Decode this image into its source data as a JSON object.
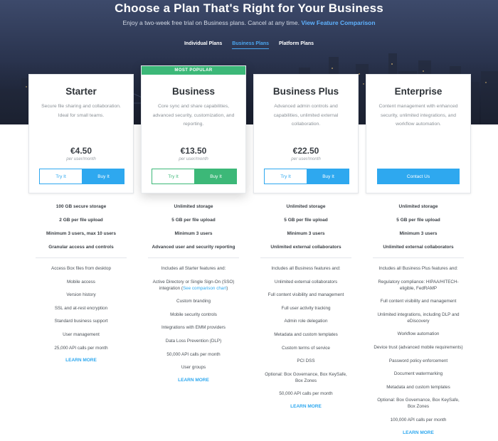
{
  "hero": {
    "title": "Choose a Plan That's Right for Your Business",
    "subtitle": "Enjoy a two-week free trial on Business plans. Cancel at any time.",
    "subtitle_link": "View Feature Comparison"
  },
  "tabs": [
    {
      "label": "Individual Plans",
      "active": false
    },
    {
      "label": "Business Plans",
      "active": true
    },
    {
      "label": "Platform Plans",
      "active": false
    }
  ],
  "colors": {
    "accent": "#2ea8ef",
    "popular": "#3cb878"
  },
  "plans": [
    {
      "name": "Starter",
      "description": "Secure file sharing and collaboration. Ideal for small teams.",
      "price": "€4.50",
      "per": "per user/month",
      "try_label": "Try It",
      "buy_label": "Buy It",
      "key_features": [
        "100 GB secure storage",
        "2 GB per file upload",
        "Minimum 3 users, max 10 users",
        "Granular access and controls"
      ],
      "features": [
        "Access Box files from desktop",
        "Mobile access",
        "Version history",
        "SSL and at-rest encryption",
        "Standard business support",
        "User management",
        "25,000 API calls per month"
      ],
      "learn_more": "LEARN MORE"
    },
    {
      "name": "Business",
      "badge": "MOST POPULAR",
      "description": "Core sync and share capabilities, advanced security, customization, and reporting.",
      "price": "€13.50",
      "per": "per user/month",
      "try_label": "Try It",
      "buy_label": "Buy It",
      "key_features": [
        "Unlimited storage",
        "5 GB per file upload",
        "Minimum 3 users",
        "Advanced user and security reporting"
      ],
      "features": [
        "Includes all Starter features and:",
        "Active Directory or Single Sign-On (SSO)",
        "Custom branding",
        "Mobile security controls",
        "Integrations with EMM providers",
        "Data Loss Prevention (DLP)",
        "50,000 API calls per month",
        "User groups"
      ],
      "sso_prefix": "integration (",
      "sso_link": "See comparison chart",
      "sso_suffix": ")",
      "learn_more": "LEARN MORE"
    },
    {
      "name": "Business Plus",
      "description": "Advanced admin controls and capabilities, unlimited external collaboration.",
      "price": "€22.50",
      "per": "per user/month",
      "try_label": "Try It",
      "buy_label": "Buy It",
      "key_features": [
        "Unlimited storage",
        "5 GB per file upload",
        "Minimum 3 users",
        "Unlimited external collaborators"
      ],
      "features": [
        "Includes all Business features and:",
        "Unlimited external collaborators",
        "Full content visibility and management",
        "Full user activity tracking",
        "Admin role delegation",
        "Metadata and custom templates",
        "Custom terms of service",
        "PCI DSS",
        "Optional: Box Governance, Box KeySafe, Box Zones",
        "50,000 API calls per month"
      ],
      "learn_more": "LEARN MORE"
    },
    {
      "name": "Enterprise",
      "description": "Content management with enhanced security, unlimited integrations, and workflow automation.",
      "contact_label": "Contact Us",
      "key_features": [
        "Unlimited storage",
        "5 GB per file upload",
        "Minimum 3 users",
        "Unlimited external collaborators"
      ],
      "features": [
        "Includes all Business Plus features and:",
        "Regulatory compliance: HIPAA/HITECH-eligible, FedRAMP",
        "Full content visibility and management",
        "Unlimited integrations, including DLP and eDiscovery",
        "Workflow automation",
        "Device trust (advanced mobile requirements)",
        "Password policy enforcement",
        "Document watermarking",
        "Metadata and custom templates",
        "Optional: Box Governance, Box KeySafe, Box Zones",
        "100,000 API calls per month"
      ],
      "learn_more": "LEARN MORE"
    }
  ]
}
